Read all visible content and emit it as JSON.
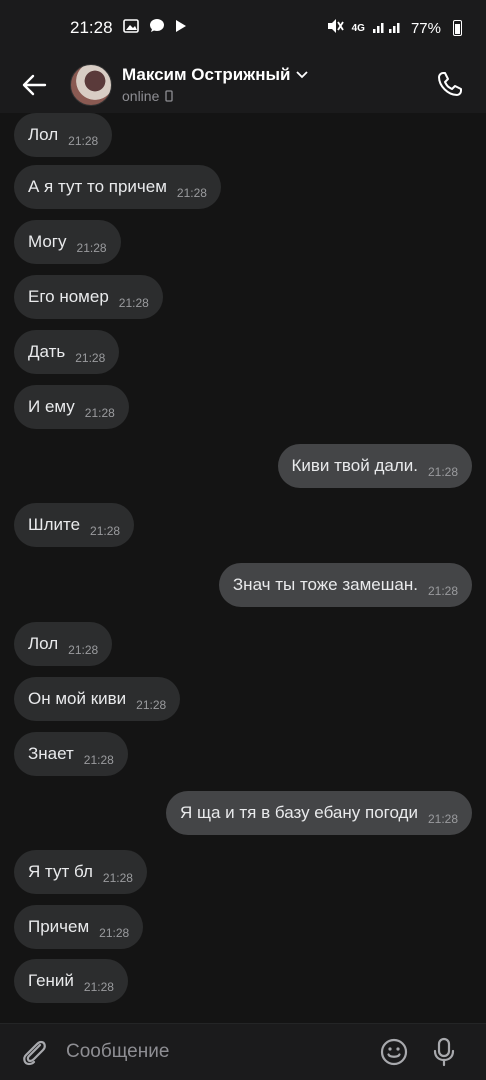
{
  "status_bar": {
    "time": "21:28",
    "network": "4G",
    "battery": "77%",
    "icons": [
      "gallery-icon",
      "chat-bubble-icon",
      "play-icon",
      "mute-icon",
      "signal-icon",
      "battery-icon"
    ]
  },
  "header": {
    "back_icon": "arrow-left-icon",
    "name": "Максим Острижный",
    "status": "online",
    "status_device_icon": "phone-device-icon",
    "call_icon": "phone-icon"
  },
  "messages": [
    {
      "text": "Лол",
      "time": "21:28",
      "direction": "in"
    },
    {
      "text": "А я тут то причем",
      "time": "21:28",
      "direction": "in"
    },
    {
      "text": "Могу",
      "time": "21:28",
      "direction": "in"
    },
    {
      "text": "Его номер",
      "time": "21:28",
      "direction": "in"
    },
    {
      "text": "Дать",
      "time": "21:28",
      "direction": "in"
    },
    {
      "text": "И ему",
      "time": "21:28",
      "direction": "in"
    },
    {
      "text": "Киви твой дали.",
      "time": "21:28",
      "direction": "out"
    },
    {
      "text": "Шлите",
      "time": "21:28",
      "direction": "in"
    },
    {
      "text": "Знач ты тоже замешан.",
      "time": "21:28",
      "direction": "out"
    },
    {
      "text": "Лол",
      "time": "21:28",
      "direction": "in"
    },
    {
      "text": "Он мой киви",
      "time": "21:28",
      "direction": "in"
    },
    {
      "text": "Знает",
      "time": "21:28",
      "direction": "in"
    },
    {
      "text": "Я ща и тя в базу ебану погоди",
      "time": "21:28",
      "direction": "out"
    },
    {
      "text": "Я тут бл",
      "time": "21:28",
      "direction": "in"
    },
    {
      "text": "Причем",
      "time": "21:28",
      "direction": "in"
    },
    {
      "text": "Гений",
      "time": "21:28",
      "direction": "in"
    }
  ],
  "composer": {
    "placeholder": "Сообщение",
    "attach_icon": "paperclip-icon",
    "emoji_icon": "smiley-icon",
    "mic_icon": "microphone-icon"
  }
}
